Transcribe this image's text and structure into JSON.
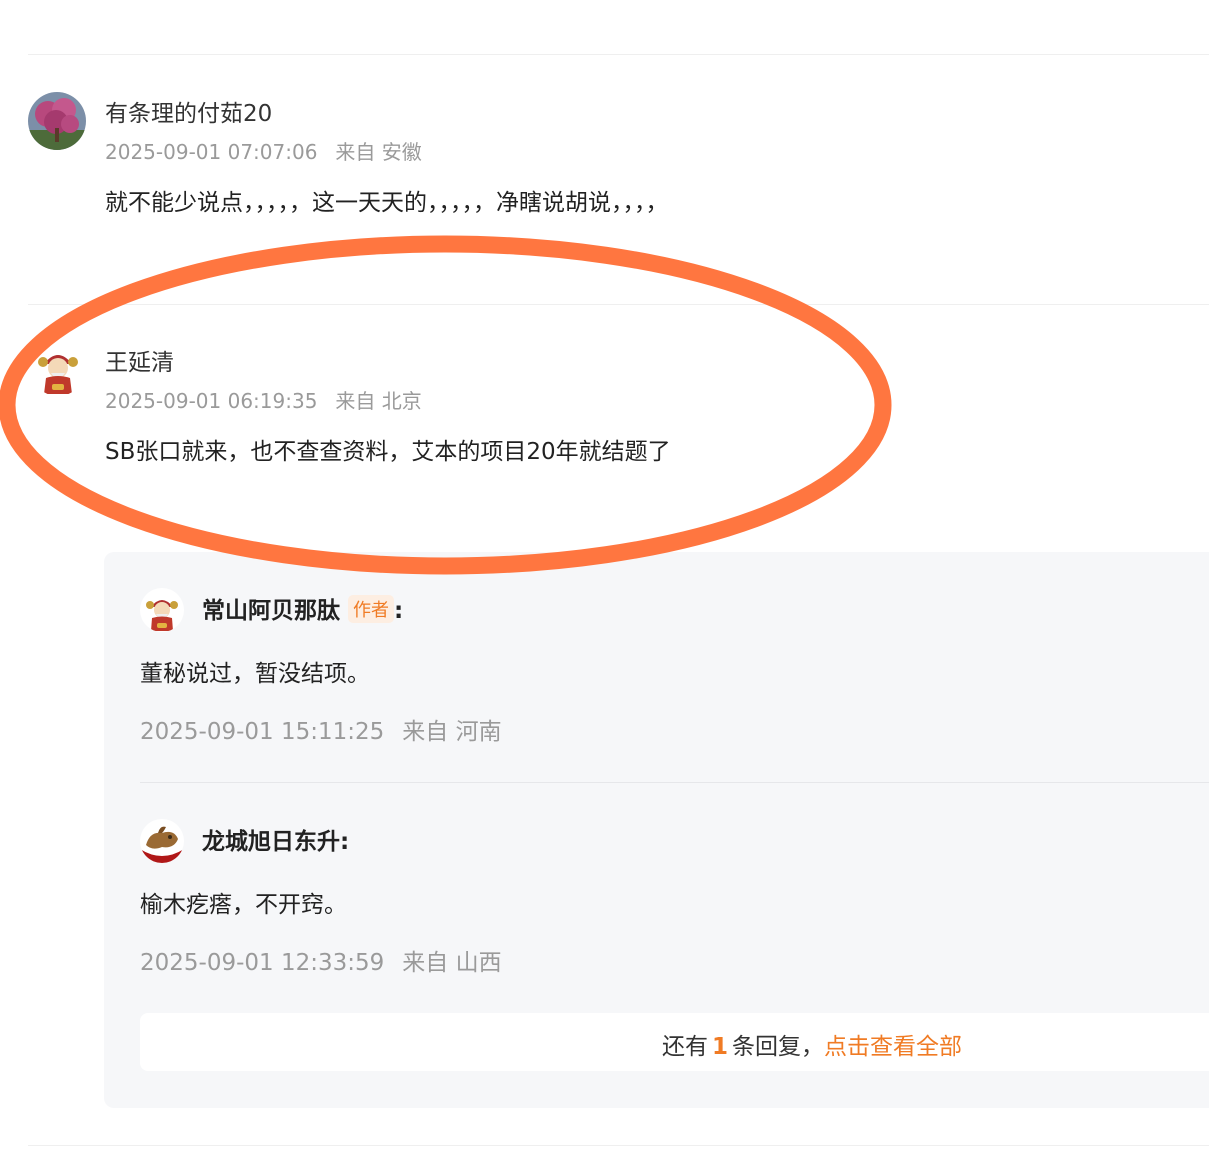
{
  "comments": [
    {
      "username": "有条理的付茹20",
      "timestamp": "2025-09-01 07:07:06",
      "location": "来自 安徽",
      "text": "就不能少说点，，，，，这一天天的，，，，，净瞎说胡说，，，，"
    },
    {
      "username": "王延清",
      "timestamp": "2025-09-01 06:19:35",
      "location": "来自 北京",
      "text": "SB张口就来，也不查查资料，艾本的项目20年就结题了",
      "replies": [
        {
          "username": "常山阿贝那肽",
          "badge": "作者",
          "suffix": ":",
          "text": "董秘说过，暂没结项。",
          "timestamp": "2025-09-01 15:11:25",
          "location": "来自 河南"
        },
        {
          "username": "龙城旭日东升:",
          "text": "榆木疙瘩，不开窍。",
          "timestamp": "2025-09-01 12:33:59",
          "location": "来自 山西"
        }
      ],
      "more_replies": {
        "prefix": "还有",
        "count": "1",
        "middle": "条回复，",
        "link": "点击查看全部"
      }
    }
  ],
  "colors": {
    "accent": "#f07b24",
    "annotation": "#ff7640",
    "muted": "#9a9a9a",
    "reply_bg": "#f6f7f9"
  }
}
